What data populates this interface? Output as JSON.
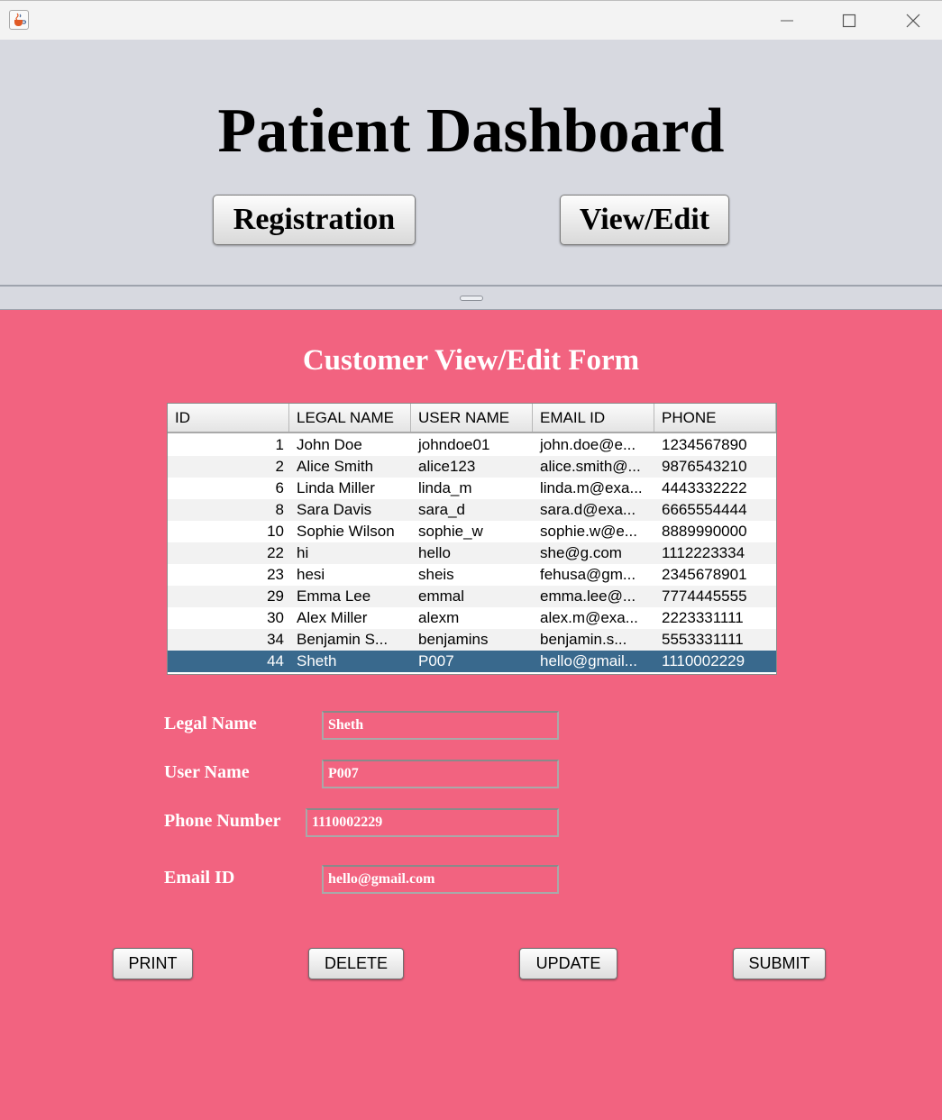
{
  "window": {
    "icon": "java-coffee-icon"
  },
  "header": {
    "title": "Patient Dashboard",
    "buttons": {
      "registration": "Registration",
      "view_edit": "View/Edit"
    }
  },
  "form": {
    "title": "Customer View/Edit Form",
    "table": {
      "columns": [
        "ID",
        "LEGAL NAME",
        "USER NAME",
        "EMAIL ID",
        "PHONE"
      ],
      "rows": [
        [
          "1",
          "John Doe",
          "johndoe01",
          "john.doe@e...",
          "1234567890"
        ],
        [
          "2",
          "Alice Smith",
          "alice123",
          "alice.smith@...",
          "9876543210"
        ],
        [
          "6",
          "Linda Miller",
          "linda_m",
          "linda.m@exa...",
          "4443332222"
        ],
        [
          "8",
          "Sara Davis",
          "sara_d",
          "sara.d@exa...",
          "6665554444"
        ],
        [
          "10",
          "Sophie Wilson",
          "sophie_w",
          "sophie.w@e...",
          "8889990000"
        ],
        [
          "22",
          "hi",
          "hello",
          "she@g.com",
          "1112223334"
        ],
        [
          "23",
          "hesi",
          "sheis",
          "fehusa@gm...",
          "2345678901"
        ],
        [
          "29",
          "Emma Lee",
          "emmal",
          "emma.lee@...",
          "7774445555"
        ],
        [
          "30",
          "Alex Miller",
          "alexm",
          "alex.m@exa...",
          "2223331111"
        ],
        [
          "34",
          "Benjamin S...",
          "benjamins",
          "benjamin.s...",
          "5553331111"
        ],
        [
          "44",
          "Sheth",
          "P007",
          "hello@gmail...",
          "1110002229"
        ]
      ],
      "selected_row": 10
    },
    "fields": {
      "legal_name": {
        "label": "Legal Name",
        "value": "Sheth"
      },
      "user_name": {
        "label": "User Name",
        "value": "P007"
      },
      "phone": {
        "label": "Phone Number",
        "value": "1110002229"
      },
      "email": {
        "label": "Email ID",
        "value": "hello@gmail.com"
      }
    },
    "buttons": {
      "print": "PRINT",
      "delete": "DELETE",
      "update": "UPDATE",
      "submit": "SUBMIT"
    }
  },
  "colors": {
    "form_background": "#f26380",
    "header_background": "#d7d9e0",
    "selected_row": "#39698d"
  }
}
